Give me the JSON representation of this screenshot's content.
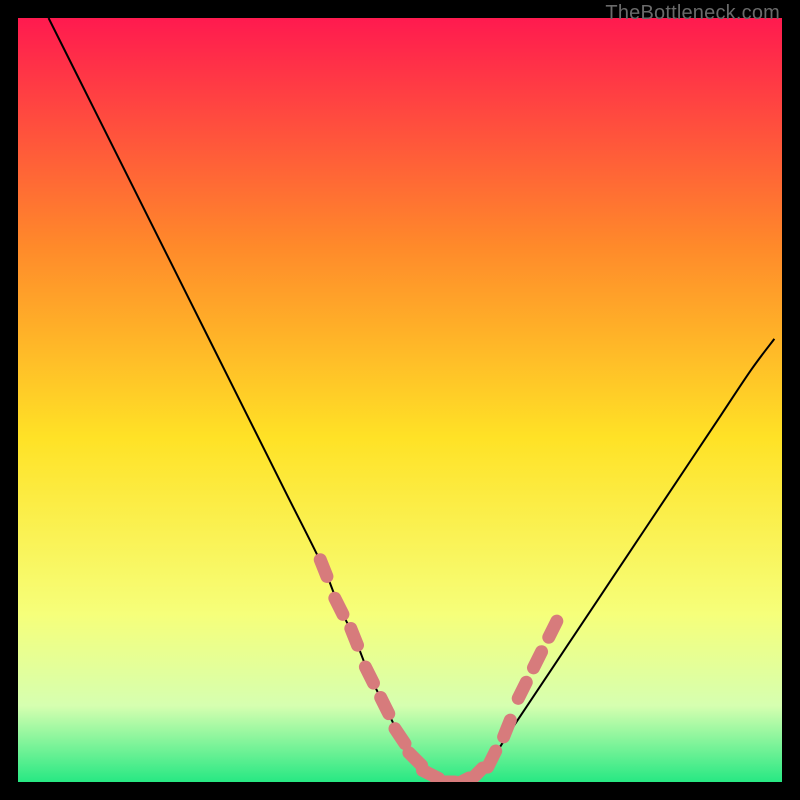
{
  "watermark": "TheBottleneck.com",
  "colors": {
    "frame": "#000000",
    "curve": "#000000",
    "marker_fill": "#d77b7c",
    "marker_stroke": "#c46969",
    "gradient": {
      "top": "#ff1a4f",
      "upper_mid": "#ff8a2a",
      "mid": "#ffe226",
      "lower_mid": "#f6ff7a",
      "low": "#d6ffb0",
      "bottom": "#27e883"
    }
  },
  "chart_data": {
    "type": "line",
    "title": "",
    "xlabel": "",
    "ylabel": "",
    "xlim": [
      0,
      100
    ],
    "ylim": [
      0,
      100
    ],
    "series": [
      {
        "name": "bottleneck-curve",
        "x": [
          4,
          10,
          15,
          20,
          25,
          30,
          35,
          40,
          42,
          44,
          46,
          48,
          50,
          52,
          54,
          56,
          58,
          60,
          62,
          64,
          68,
          72,
          76,
          80,
          84,
          88,
          92,
          96,
          99
        ],
        "y": [
          100,
          88,
          78,
          68,
          58,
          48,
          38,
          28,
          23,
          19,
          14,
          10,
          6,
          3,
          1,
          0,
          0,
          1,
          3,
          6,
          12,
          18,
          24,
          30,
          36,
          42,
          48,
          54,
          58
        ]
      }
    ],
    "markers": {
      "name": "hotspot-dots",
      "x": [
        40,
        42,
        44,
        46,
        48,
        50,
        52,
        54,
        56,
        58,
        60,
        62,
        64,
        66,
        68,
        70
      ],
      "y": [
        28,
        23,
        19,
        14,
        10,
        6,
        3,
        1,
        0,
        0,
        1,
        3,
        7,
        12,
        16,
        20
      ]
    }
  }
}
